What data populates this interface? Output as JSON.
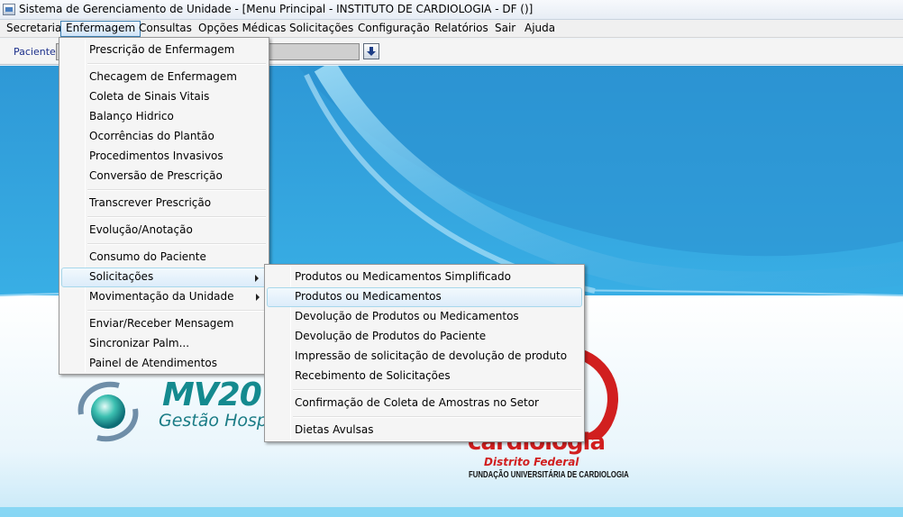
{
  "window": {
    "title": "Sistema de Gerenciamento de Unidade - [Menu Principal - INSTITUTO DE CARDIOLOGIA - DF ()]"
  },
  "menubar": {
    "items": [
      "Secretaria",
      "Enfermagem",
      "Consultas",
      "Opções Médicas",
      "Solicitações",
      "Configuração",
      "Relatórios",
      "Sair",
      "Ajuda"
    ],
    "active": "Enfermagem"
  },
  "toolbar": {
    "patient_label": "Paciente",
    "patient_value": ""
  },
  "enfermagem_menu": {
    "items": [
      "Prescrição de Enfermagem",
      "Checagem de Enfermagem",
      "Coleta de Sinais Vitais",
      "Balanço Hidrico",
      "Ocorrências do Plantão",
      "Procedimentos Invasivos",
      "Conversão de Prescrição",
      "Transcrever Prescrição",
      "Evolução/Anotação",
      "Consumo do Paciente",
      "Solicitações",
      "Movimentação da Unidade",
      "Enviar/Receber Mensagem",
      "Sincronizar Palm...",
      "Painel de Atendimentos"
    ],
    "highlighted": "Solicitações"
  },
  "solicitacoes_submenu": {
    "items": [
      "Produtos ou Medicamentos Simplificado",
      "Produtos ou Medicamentos",
      "Devolução de Produtos ou Medicamentos",
      "Devolução de Produtos do Paciente",
      "Impressão de solicitação de devolução de produto",
      "Recebimento de Solicitações",
      "Confirmação de Coleta de Amostras no Setor",
      "Dietas Avulsas"
    ],
    "highlighted": "Produtos ou Medicamentos"
  },
  "logos": {
    "mv": {
      "name": "MV20",
      "tagline": "Gestão Hospi"
    },
    "cardiologia": {
      "word": "cardiologia",
      "region": "Distrito Federal",
      "foundation": "FUNDAÇÃO UNIVERSITÁRIA DE CARDIOLOGIA"
    }
  },
  "colors": {
    "menu_highlight": "#dcecfa",
    "background_blue": "#2ea3dd",
    "mv_teal": "#148a8f",
    "cardio_red": "#d11f1f"
  }
}
